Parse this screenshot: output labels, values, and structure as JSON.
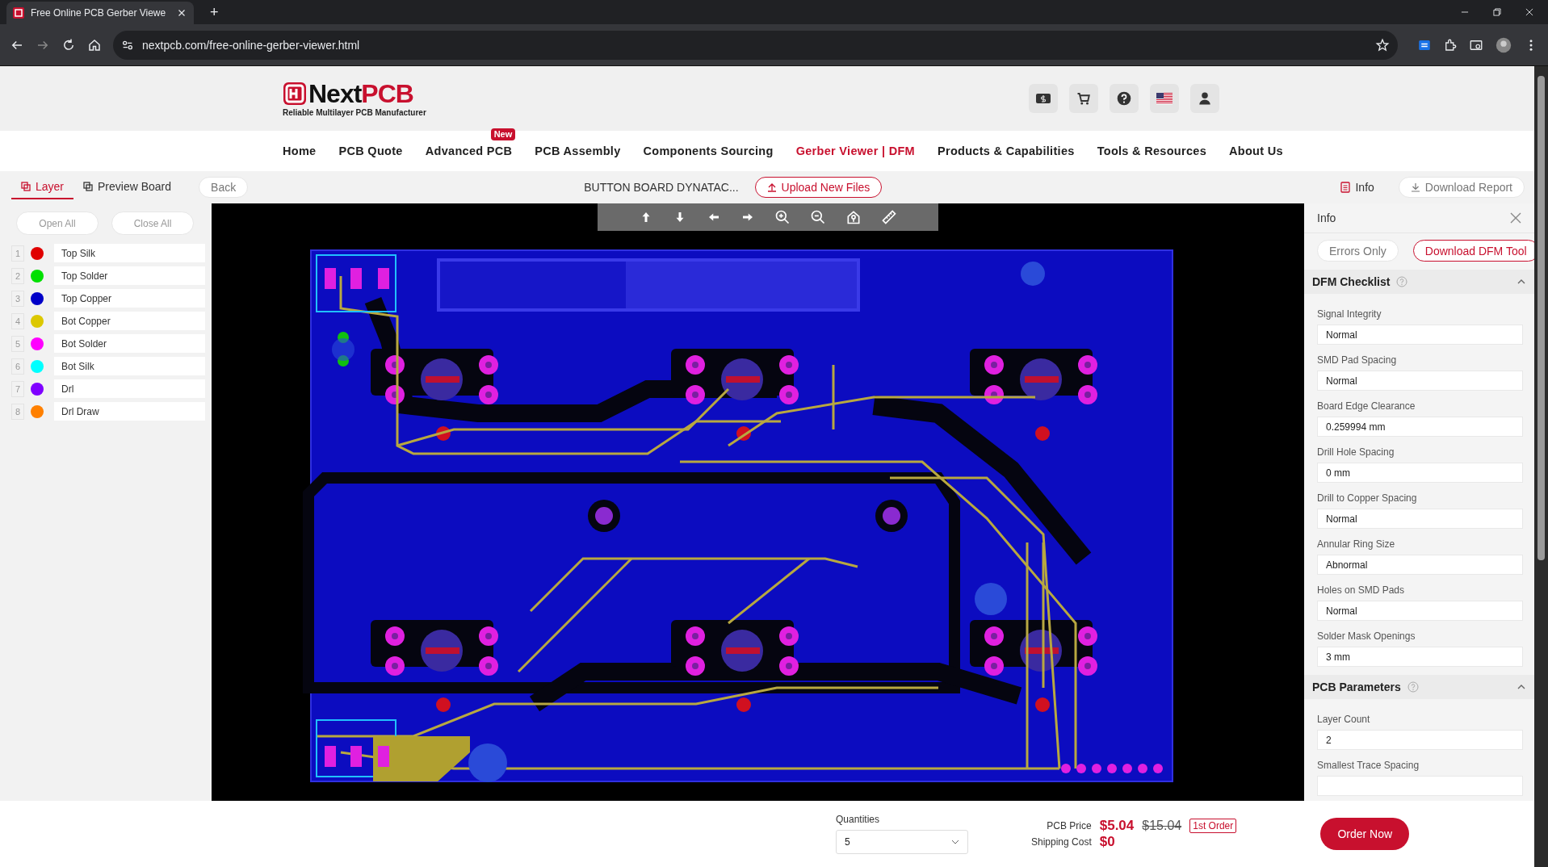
{
  "browser": {
    "tab_title": "Free Online PCB Gerber Viewe",
    "new_tab": "+",
    "url": "nextpcb.com/free-online-gerber-viewer.html"
  },
  "header": {
    "logo_part_1": "Next",
    "logo_part_2": "PCB",
    "tagline": "Reliable Multilayer PCB Manufacturer"
  },
  "nav": [
    {
      "label": "Home",
      "selected": false
    },
    {
      "label": "PCB Quote",
      "selected": false
    },
    {
      "label": "Advanced PCB",
      "selected": false,
      "badge": "New"
    },
    {
      "label": "PCB Assembly",
      "selected": false
    },
    {
      "label": "Components Sourcing",
      "selected": false
    },
    {
      "label": "Gerber Viewer | DFM",
      "selected": true
    },
    {
      "label": "Products & Capabilities",
      "selected": false
    },
    {
      "label": "Tools & Resources",
      "selected": false
    },
    {
      "label": "About Us",
      "selected": false
    }
  ],
  "toolbar": {
    "tabs": [
      {
        "label": "Layer",
        "selected": true
      },
      {
        "label": "Preview Board",
        "selected": false
      }
    ],
    "back": "Back",
    "file_name": "BUTTON BOARD DYNATAC...",
    "upload": "Upload New Files",
    "info": "Info",
    "download_report": "Download Report"
  },
  "layers_panel": {
    "open_all": "Open All",
    "close_all": "Close All",
    "layers": [
      {
        "number": "1",
        "name": "Top Silk",
        "color": "#e00000"
      },
      {
        "number": "2",
        "name": "Top Solder",
        "color": "#00e000"
      },
      {
        "number": "3",
        "name": "Top Copper",
        "color": "#0000c8"
      },
      {
        "number": "4",
        "name": "Bot Copper",
        "color": "#dcc800"
      },
      {
        "number": "5",
        "name": "Bot Solder",
        "color": "#ff00ff"
      },
      {
        "number": "6",
        "name": "Bot Silk",
        "color": "#00ffff"
      },
      {
        "number": "7",
        "name": "Drl",
        "color": "#7f00ff"
      },
      {
        "number": "8",
        "name": "Drl Draw",
        "color": "#ff8000"
      }
    ]
  },
  "info_panel": {
    "title": "Info",
    "errors_only": "Errors Only",
    "download_tool": "Download DFM Tool",
    "sections": [
      {
        "title": "DFM Checklist",
        "expanded": true,
        "fields": [
          {
            "label": "Signal Integrity",
            "value": "Normal"
          },
          {
            "label": "SMD Pad Spacing",
            "value": "Normal"
          },
          {
            "label": "Board Edge Clearance",
            "value": "0.259994 mm"
          },
          {
            "label": "Drill Hole Spacing",
            "value": "0 mm"
          },
          {
            "label": "Drill to Copper Spacing",
            "value": "Normal"
          },
          {
            "label": "Annular Ring Size",
            "value": "Abnormal"
          },
          {
            "label": "Holes on SMD Pads",
            "value": "Normal"
          },
          {
            "label": "Solder Mask Openings",
            "value": "3 mm"
          }
        ]
      },
      {
        "title": "PCB Parameters",
        "expanded": true,
        "fields": [
          {
            "label": "Layer Count",
            "value": "2"
          },
          {
            "label": "Smallest Trace Spacing"
          }
        ]
      }
    ]
  },
  "order_bar": {
    "quantities_label": "Quantities",
    "quantity": "5",
    "pcb_price_label": "PCB Price",
    "pcb_price": "$5.04",
    "old_price": "$15.04",
    "first_order": "1st Order",
    "shipping_label": "Shipping Cost",
    "shipping": "$0",
    "order_now": "Order Now"
  }
}
